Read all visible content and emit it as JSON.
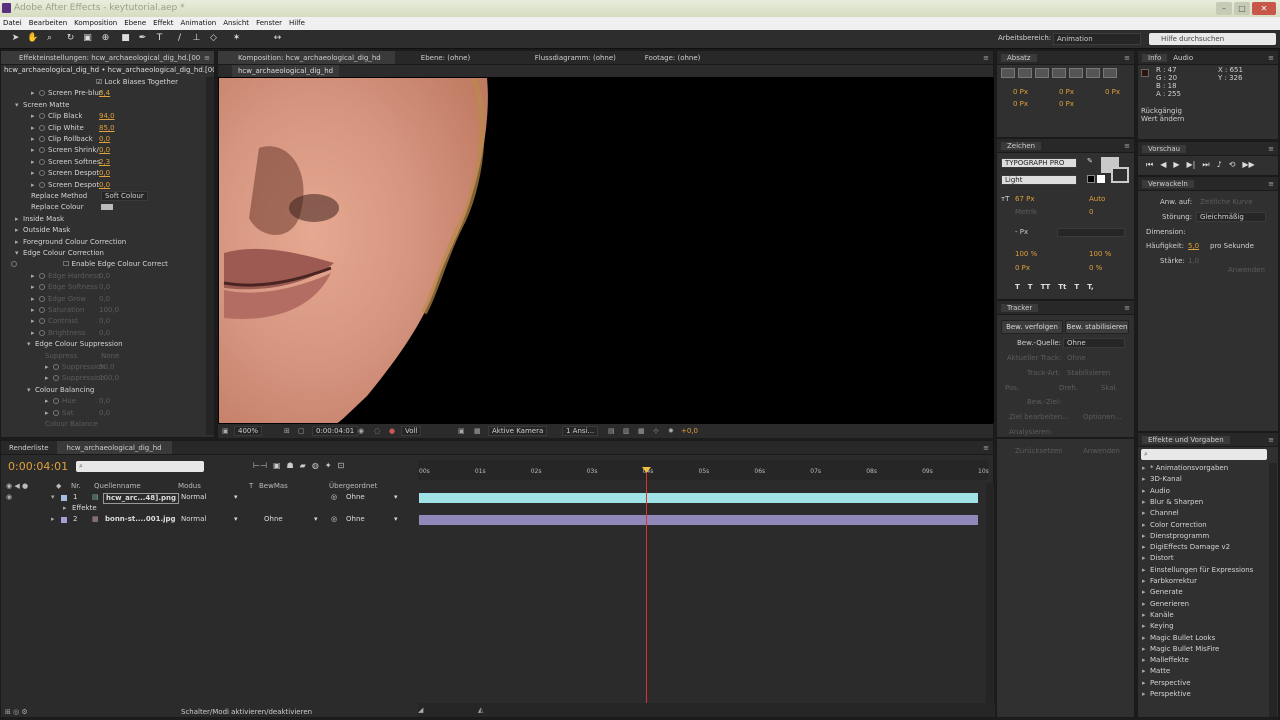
{
  "app": {
    "title": "Adobe After Effects - keytutorial.aep *"
  },
  "menu": [
    "Datei",
    "Bearbeiten",
    "Komposition",
    "Ebene",
    "Effekt",
    "Animation",
    "Ansicht",
    "Fenster",
    "Hilfe"
  ],
  "toolbar": {
    "workspace_label": "Arbeitsbereich:",
    "workspace_value": "Animation",
    "search_placeholder": "Hilfe durchsuchen"
  },
  "effects": {
    "tab": "Effekteinstellungen: hcw_archaeological_dig_hd.[00",
    "crumb": "hcw_archaeological_dig_hd • hcw_archaeological_dig_hd.[0000-0",
    "rows": [
      {
        "label": "Lock Biases Together",
        "indent": 95,
        "type": "check"
      },
      {
        "label": "Screen Pre-blur",
        "value": "3,4",
        "indent": 30,
        "type": "param"
      },
      {
        "label": "Screen Matte",
        "indent": 14,
        "type": "group"
      },
      {
        "label": "Clip Black",
        "value": "94,0",
        "indent": 30,
        "type": "param"
      },
      {
        "label": "Clip White",
        "value": "85,0",
        "indent": 30,
        "type": "param"
      },
      {
        "label": "Clip Rollback",
        "value": "0,0",
        "indent": 30,
        "type": "param"
      },
      {
        "label": "Screen Shrink/",
        "value": "0,0",
        "indent": 30,
        "type": "param"
      },
      {
        "label": "Screen Softnes",
        "value": "2,3",
        "indent": 30,
        "type": "param"
      },
      {
        "label": "Screen Despot",
        "value": "0,0",
        "indent": 30,
        "type": "param"
      },
      {
        "label": "Screen Despot",
        "value": "0,0",
        "indent": 30,
        "type": "param"
      },
      {
        "label": "Replace Method",
        "value": "Soft Colour",
        "indent": 30,
        "type": "drop"
      },
      {
        "label": "Replace Colour",
        "indent": 30,
        "type": "color"
      },
      {
        "label": "Inside Mask",
        "indent": 14,
        "type": "groupc"
      },
      {
        "label": "Outside Mask",
        "indent": 14,
        "type": "groupc"
      },
      {
        "label": "Foreground Colour Correction",
        "indent": 14,
        "type": "groupc"
      },
      {
        "label": "Edge Colour Correction",
        "indent": 14,
        "type": "group"
      },
      {
        "label": "Enable Edge Colour Correct",
        "indent": 30,
        "type": "enable"
      },
      {
        "label": "Edge Hardness",
        "value": "0,0",
        "indent": 30,
        "type": "dimparam"
      },
      {
        "label": "Edge Softness",
        "value": "0,0",
        "indent": 30,
        "type": "dimparam"
      },
      {
        "label": "Edge Grow",
        "value": "0,0",
        "indent": 30,
        "type": "dimparam"
      },
      {
        "label": "Saturation",
        "value": "100,0",
        "indent": 30,
        "type": "dimparam"
      },
      {
        "label": "Contrast",
        "value": "0,0",
        "indent": 30,
        "type": "dimparam"
      },
      {
        "label": "Brightness",
        "value": "0,0",
        "indent": 30,
        "type": "dimparam"
      },
      {
        "label": "Edge Colour Suppression",
        "indent": 26,
        "type": "group"
      },
      {
        "label": "Suppress",
        "value": "None",
        "indent": 44,
        "type": "dimdrop"
      },
      {
        "label": "Suppression",
        "value": "50,0",
        "indent": 44,
        "type": "dimparam"
      },
      {
        "label": "Suppression",
        "value": "100,0",
        "indent": 44,
        "type": "dimparam"
      },
      {
        "label": "Colour Balancing",
        "indent": 26,
        "type": "group"
      },
      {
        "label": "Hue",
        "value": "0,0",
        "indent": 44,
        "type": "dimparam"
      },
      {
        "label": "Sat",
        "value": "0,0",
        "indent": 44,
        "type": "dimparam"
      },
      {
        "label": "Colour Balance",
        "indent": 44,
        "type": "dimtext"
      }
    ]
  },
  "comp": {
    "tab": "Komposition: hcw_archaeological_dig_hd",
    "subtab": "hcw_archaeological_dig_hd",
    "layer_tab": "Ebene: (ohne)",
    "flow_tab": "Flussdiagramm: (ohne)",
    "footage_tab": "Footage: (ohne)",
    "zoom": "400%",
    "timecode": "0:00:04:01",
    "resolution": "Voll",
    "camera": "Aktive Kamera",
    "views": "1 Ansi...",
    "exposure": "+0,0"
  },
  "info": {
    "tab": "Info",
    "audio_tab": "Audio",
    "r": "R : 47",
    "g": "G : 20",
    "b": "B : 18",
    "a": "A : 255",
    "x": "X : 651",
    "y": "Y : 326",
    "undo": "Rückgängig",
    "undo2": "Wert ändern"
  },
  "preview": {
    "tab": "Vorschau"
  },
  "wiggler": {
    "tab": "Verwackeln",
    "apply_label": "Anw. auf:",
    "apply_val": "Zeitliche Kurve",
    "noise_label": "Störung:",
    "noise_val": "Gleichmäßig",
    "dim_label": "Dimension:",
    "freq_label": "Häufigkeit:",
    "freq_val": "5,0",
    "freq_unit": "pro Sekunde",
    "mag_label": "Stärke:",
    "mag_val": "1,0",
    "apply_btn": "Anwenden"
  },
  "paragraph": {
    "tab": "Absatz",
    "vals": [
      "0 Px",
      "0 Px",
      "0 Px",
      "0 Px",
      "0 Px"
    ]
  },
  "character": {
    "tab": "Zeichen",
    "font": "TYPOGRAPH PRO",
    "style": "Light",
    "size": "67 Px",
    "leading": "Auto",
    "tracking_label": "Metrik",
    "tracking": "0",
    "stroke": "- Px",
    "vscale": "100 %",
    "hscale": "100 %",
    "baseline": "0 Px",
    "tsume": "0 %",
    "styles": [
      "T",
      "T",
      "TT",
      "Tt",
      "T",
      "T,"
    ]
  },
  "tracker": {
    "tab": "Tracker",
    "btn_track": "Bew. verfolgen",
    "btn_stab": "Bew. stabilisieren",
    "src_label": "Bew.-Quelle:",
    "src_val": "Ohne",
    "cur_label": "Aktueller Track:",
    "cur_val": "Ohne",
    "type_label": "Track-Art:",
    "type_val": "Stabilisieren",
    "pos": "Pos.",
    "rot": "Dreh.",
    "scale": "Skal.",
    "target": "Bew.-Ziel:",
    "edit": "Ziel bearbeiten...",
    "options": "Optionen...",
    "analyze": "Analysieren:",
    "reset": "Zurücksetzen",
    "apply": "Anwenden"
  },
  "effects_presets": {
    "tab": "Effekte und Vorgaben",
    "items": [
      "* Animationsvorgaben",
      "3D-Kanal",
      "Audio",
      "Blur & Sharpen",
      "Channel",
      "Color Correction",
      "Dienstprogramm",
      "DigiEffects Damage v2",
      "Distort",
      "Einstellungen für Expressions",
      "Farbkorrektur",
      "Generate",
      "Generieren",
      "Kanäle",
      "Keying",
      "Magic Bullet Looks",
      "Magic Bullet MisFire",
      "Malleffekte",
      "Matte",
      "Perspective",
      "Perspektive"
    ]
  },
  "timeline": {
    "render_tab": "Renderliste",
    "comp_tab": "hcw_archaeological_dig_hd",
    "timecode": "0:00:04:01",
    "cols": {
      "nr": "Nr.",
      "name": "Quellenname",
      "mode": "Modus",
      "t": "T",
      "trkmat": "BewMas",
      "parent": "Übergeordnet"
    },
    "layers": [
      {
        "nr": "1",
        "name": "hcw_arc...48].png",
        "mode": "Normal",
        "trkmat": "",
        "parent": "Ohne"
      },
      {
        "nr": "2",
        "name": "bonn-st....001.jpg",
        "mode": "Normal",
        "trkmat": "Ohne",
        "parent": "Ohne"
      }
    ],
    "effects_label": "Effekte",
    "ticks": [
      "00s",
      "01s",
      "02s",
      "03s",
      "04s",
      "05s",
      "06s",
      "07s",
      "08s",
      "09s",
      "10s"
    ],
    "toggle": "Schalter/Modi aktivieren/deaktivieren"
  }
}
